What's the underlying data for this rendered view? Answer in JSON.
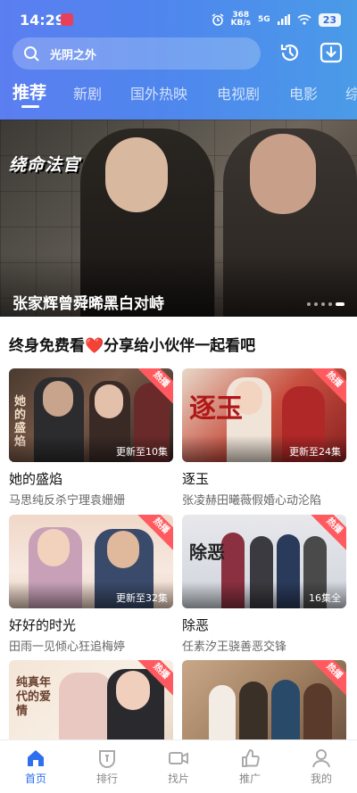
{
  "status": {
    "time": "14:29",
    "net_speed": "368",
    "net_unit": "KB/s",
    "signal": "5G",
    "battery": "23"
  },
  "search": {
    "placeholder": "光阴之外"
  },
  "tabs": [
    {
      "label": "推荐",
      "active": true
    },
    {
      "label": "新剧",
      "active": false
    },
    {
      "label": "国外热映",
      "active": false
    },
    {
      "label": "电视剧",
      "active": false
    },
    {
      "label": "电影",
      "active": false
    },
    {
      "label": "综",
      "active": false
    }
  ],
  "hero": {
    "logo_text": "绕命法官",
    "caption": "张家辉曾舜晞黑白对峙",
    "page_count": 5,
    "active_page": 4
  },
  "section": {
    "title": "终身免费看❤️分享给小伙伴一起看吧"
  },
  "cards": [
    {
      "title": "她的盛焰",
      "subtitle": "马思纯反杀宁理袁姗姗",
      "badge": "热播",
      "episodes": "更新至10集",
      "poster_text": "她的盛焰"
    },
    {
      "title": "逐玉",
      "subtitle": "张凌赫田曦薇假婚心动沦陷",
      "badge": "热播",
      "episodes": "更新至24集",
      "poster_text": "逐玉"
    },
    {
      "title": "好好的时光",
      "subtitle": "田雨一见倾心狂追梅婷",
      "badge": "热播",
      "episodes": "更新至32集",
      "poster_text": ""
    },
    {
      "title": "除恶",
      "subtitle": "任素汐王骁善恶交锋",
      "badge": "热播",
      "episodes": "16集全",
      "poster_text": "除恶"
    },
    {
      "title": "",
      "subtitle": "",
      "badge": "热播",
      "episodes": "",
      "poster_text": "纯真年代的爱情"
    },
    {
      "title": "",
      "subtitle": "",
      "badge": "热播",
      "episodes": "",
      "poster_text": ""
    }
  ],
  "bottom_nav": [
    {
      "label": "首页",
      "icon": "home-icon",
      "active": true
    },
    {
      "label": "排行",
      "icon": "ranking-icon",
      "active": false
    },
    {
      "label": "找片",
      "icon": "video-camera-icon",
      "active": false
    },
    {
      "label": "推广",
      "icon": "thumbs-up-icon",
      "active": false
    },
    {
      "label": "我的",
      "icon": "profile-icon",
      "active": false
    }
  ],
  "colors": {
    "accent": "#2e6ff0",
    "badge": "#ff5a5f",
    "header_start": "#5b7ef0",
    "header_end": "#4a9be8"
  }
}
